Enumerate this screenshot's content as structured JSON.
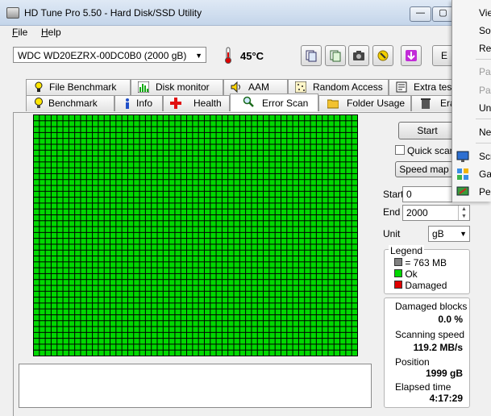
{
  "window": {
    "title": "HD Tune Pro 5.50 - Hard Disk/SSD Utility",
    "minimize_glyph": "—",
    "maximize_glyph": "▢"
  },
  "menu": {
    "file": "File",
    "help": "Help"
  },
  "toolbar": {
    "drive": "WDC WD20EZRX-00DC0B0 (2000 gB)",
    "temperature": "45",
    "temperature_unit": "°C",
    "exit_label": "E"
  },
  "tabs_top": [
    {
      "label": "File Benchmark",
      "icon": "file-benchmark-icon"
    },
    {
      "label": "Disk monitor",
      "icon": "disk-monitor-icon"
    },
    {
      "label": "AAM",
      "icon": "speaker-icon"
    },
    {
      "label": "Random Access",
      "icon": "random-access-icon"
    },
    {
      "label": "Extra tes",
      "icon": "extra-tests-icon"
    }
  ],
  "tabs_bottom": [
    {
      "label": "Benchmark",
      "icon": "lightbulb-icon"
    },
    {
      "label": "Info",
      "icon": "info-icon"
    },
    {
      "label": "Health",
      "icon": "health-cross-icon"
    },
    {
      "label": "Error Scan",
      "icon": "magnifier-icon",
      "active": true
    },
    {
      "label": "Folder Usage",
      "icon": "folder-icon"
    },
    {
      "label": "Era",
      "icon": "trash-icon"
    }
  ],
  "scan": {
    "grid_status": "ok",
    "ok_color": "#00d800",
    "grid_line_color": "#000000",
    "grid_cols": 55,
    "grid_rows": 41
  },
  "controls": {
    "start_button": "Start",
    "quick_scan": "Quick scan",
    "quick_scan_checked": false,
    "speed_map": "Speed map",
    "start_label": "Start",
    "start_value": "0",
    "end_label": "End",
    "end_value": "2000",
    "unit_label": "Unit",
    "unit_value": "gB"
  },
  "legend": {
    "title": "Legend",
    "items": [
      {
        "label": "= 763 MB",
        "color": "#808080"
      },
      {
        "label": "Ok",
        "color": "#00d800"
      },
      {
        "label": "Damaged",
        "color": "#e00000"
      }
    ]
  },
  "stats": {
    "damaged_blocks_label": "Damaged blocks",
    "damaged_blocks_value": "0.0 %",
    "scanning_speed_label": "Scanning speed",
    "scanning_speed_value": "119.2 MB/s",
    "position_label": "Position",
    "position_value": "1999 gB",
    "elapsed_label": "Elapsed time",
    "elapsed_value": "4:17:29"
  },
  "popup_menu": [
    {
      "label": "View",
      "disabled": false
    },
    {
      "label": "So",
      "disabled": false
    },
    {
      "label": "Re",
      "disabled": false
    },
    {
      "label": "Pa",
      "disabled": true
    },
    {
      "label": "Pa",
      "disabled": true
    },
    {
      "label": "Un",
      "disabled": false
    },
    {
      "label": "Ne",
      "disabled": false
    },
    {
      "label": "Scr",
      "disabled": false,
      "icon": "screen-icon"
    },
    {
      "label": "Ga",
      "disabled": false,
      "icon": "gadgets-icon"
    },
    {
      "label": "Pe",
      "disabled": false,
      "icon": "personalize-icon"
    }
  ]
}
